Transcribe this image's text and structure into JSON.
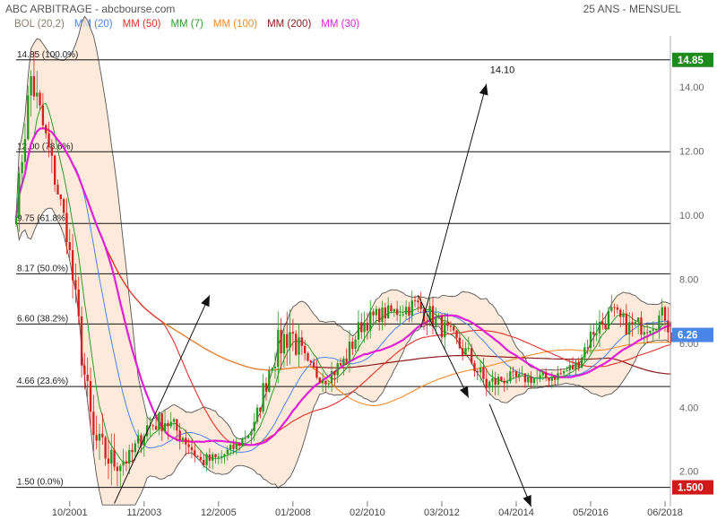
{
  "header": {
    "title": "ABC ARBITRAGE - abcbourse.com",
    "period": "25 ANS - MENSUEL"
  },
  "legend": [
    {
      "label": "BOL (20,2)",
      "color": "#8b7d6b"
    },
    {
      "label": "MM (20)",
      "color": "#4a86e8"
    },
    {
      "label": "MM (50)",
      "color": "#e0302a"
    },
    {
      "label": "MM (7)",
      "color": "#2e9b2e"
    },
    {
      "label": "MM (100)",
      "color": "#f28c28"
    },
    {
      "label": "MM (200)",
      "color": "#8b1a1a"
    },
    {
      "label": "MM (30)",
      "color": "#e020d8"
    }
  ],
  "chart_data": {
    "type": "candlestick",
    "x_ticks": [
      "10/2001",
      "11/2003",
      "12/2005",
      "01/2008",
      "02/2010",
      "03/2012",
      "04/2014",
      "05/2016",
      "06/2018"
    ],
    "x_range": [
      "04/2000",
      "09/2018"
    ],
    "y_ticks": [
      2.0,
      4.0,
      6.0,
      8.0,
      10.0,
      12.0,
      14.0
    ],
    "y_tick_labels": [
      "2.00",
      "4.00",
      "6.00",
      "8.00",
      "10.00",
      "12.00",
      "14.00"
    ],
    "ylim": [
      0.9,
      15.6
    ],
    "grid": false,
    "last_price": {
      "label": "6.26",
      "value": 6.26,
      "color": "#4a86e8"
    },
    "max_marker": {
      "label": "14.85",
      "value": 14.85,
      "color": "#1d8a1d"
    },
    "min_marker": {
      "label": "1.500",
      "value": 1.5,
      "color": "#d01a1a"
    },
    "fibonacci_levels": [
      {
        "label": "14.85  (100.0%)",
        "value": 14.85
      },
      {
        "label": "12.00  (78.6%)",
        "value": 11.98
      },
      {
        "label": "9.75  (61.8%)",
        "value": 9.74
      },
      {
        "label": "8.17  (50.0%)",
        "value": 8.17
      },
      {
        "label": "6.60  (38.2%)",
        "value": 6.6
      },
      {
        "label": "4.66  (23.6%)",
        "value": 4.65
      },
      {
        "label": "1.50  (0.0%)",
        "value": 1.5
      }
    ],
    "annotation": {
      "label": "14.10",
      "value": 14.1
    },
    "arrows": [
      {
        "from": [
          "01/2003",
          1.0
        ],
        "to": [
          "09/2005",
          7.5
        ]
      },
      {
        "from": [
          "08/2011",
          6.5
        ],
        "to": [
          "06/2013",
          14.1
        ]
      },
      {
        "from": [
          "07/2011",
          7.5
        ],
        "to": [
          "12/2012",
          4.3
        ]
      },
      {
        "from": [
          "07/2013",
          4.1
        ],
        "to": [
          "09/2014",
          0.9
        ]
      }
    ],
    "anchors": [
      [
        "04/2000",
        10.2,
        9.6,
        10.6
      ],
      [
        "09/2000",
        14.3,
        12.5,
        14.85
      ],
      [
        "03/2001",
        12.0,
        11.0,
        12.6
      ],
      [
        "09/2001",
        9.5,
        8.8,
        10.2
      ],
      [
        "03/2002",
        5.0,
        4.2,
        6.5
      ],
      [
        "06/2002",
        3.0,
        2.3,
        4.0
      ],
      [
        "12/2002",
        2.3,
        1.5,
        3.5
      ],
      [
        "06/2003",
        2.4,
        1.9,
        3.0
      ],
      [
        "12/2003",
        3.4,
        2.8,
        3.9
      ],
      [
        "06/2004",
        3.6,
        3.0,
        4.3
      ],
      [
        "12/2004",
        3.1,
        2.6,
        3.7
      ],
      [
        "06/2005",
        2.3,
        1.9,
        2.8
      ],
      [
        "12/2005",
        2.4,
        2.0,
        2.8
      ],
      [
        "06/2006",
        2.8,
        2.5,
        3.1
      ],
      [
        "12/2006",
        3.4,
        3.0,
        3.9
      ],
      [
        "06/2007",
        5.6,
        4.5,
        6.5
      ],
      [
        "12/2007",
        6.4,
        5.5,
        7.6
      ],
      [
        "06/2008",
        5.2,
        4.6,
        5.8
      ],
      [
        "12/2008",
        4.9,
        4.5,
        5.3
      ],
      [
        "06/2009",
        5.4,
        4.8,
        6.0
      ],
      [
        "12/2009",
        6.6,
        6.0,
        7.2
      ],
      [
        "06/2010",
        6.9,
        6.4,
        7.3
      ],
      [
        "12/2010",
        7.0,
        6.5,
        7.4
      ],
      [
        "06/2011",
        7.2,
        6.7,
        7.9
      ],
      [
        "12/2011",
        6.8,
        6.1,
        7.4
      ],
      [
        "06/2012",
        6.2,
        5.6,
        6.8
      ],
      [
        "12/2012",
        5.6,
        5.0,
        6.2
      ],
      [
        "06/2013",
        4.7,
        4.2,
        5.3
      ],
      [
        "12/2013",
        4.9,
        4.4,
        5.3
      ],
      [
        "06/2014",
        4.9,
        4.5,
        5.2
      ],
      [
        "12/2014",
        4.9,
        4.5,
        5.2
      ],
      [
        "06/2015",
        5.0,
        4.6,
        5.3
      ],
      [
        "12/2015",
        5.3,
        4.9,
        5.8
      ],
      [
        "06/2016",
        6.4,
        5.7,
        6.9
      ],
      [
        "12/2016",
        6.9,
        6.3,
        7.6
      ],
      [
        "06/2017",
        6.5,
        5.9,
        7.0
      ],
      [
        "12/2017",
        6.6,
        6.0,
        7.2
      ],
      [
        "06/2018",
        6.9,
        6.4,
        7.5
      ],
      [
        "08/2018",
        6.26,
        6.0,
        7.3
      ]
    ]
  }
}
